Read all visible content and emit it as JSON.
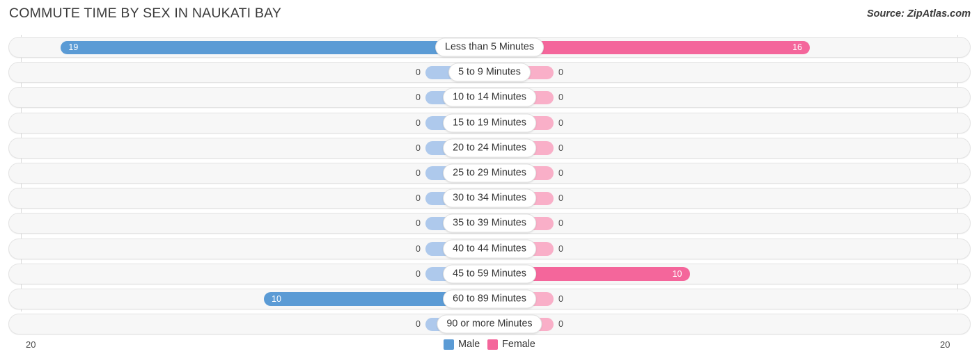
{
  "header": {
    "title": "COMMUTE TIME BY SEX IN NAUKATI BAY",
    "source": "Source: ZipAtlas.com"
  },
  "legend": {
    "items": [
      {
        "label": "Male",
        "color": "#5b9bd5"
      },
      {
        "label": "Female",
        "color": "#f4669b"
      }
    ]
  },
  "axis": {
    "left_label": "20",
    "right_label": "20"
  },
  "chart_data": {
    "type": "bar",
    "subtype": "diverging-horizontal-bar",
    "title": "COMMUTE TIME BY SEX IN NAUKATI BAY",
    "xlabel": "",
    "ylabel": "",
    "xlim": [
      20,
      20
    ],
    "axis_max": 20,
    "grid": true,
    "legend_position": "bottom-center",
    "categories": [
      "Less than 5 Minutes",
      "5 to 9 Minutes",
      "10 to 14 Minutes",
      "15 to 19 Minutes",
      "20 to 24 Minutes",
      "25 to 29 Minutes",
      "30 to 34 Minutes",
      "35 to 39 Minutes",
      "40 to 44 Minutes",
      "45 to 59 Minutes",
      "60 to 89 Minutes",
      "90 or more Minutes"
    ],
    "series": [
      {
        "name": "Male",
        "color": "#5b9bd5",
        "direction": "left",
        "values": [
          19,
          0,
          0,
          0,
          0,
          0,
          0,
          0,
          0,
          0,
          10,
          0
        ]
      },
      {
        "name": "Female",
        "color": "#f4669b",
        "direction": "right",
        "values": [
          16,
          0,
          0,
          0,
          0,
          0,
          0,
          0,
          0,
          10,
          0,
          0
        ]
      }
    ]
  }
}
